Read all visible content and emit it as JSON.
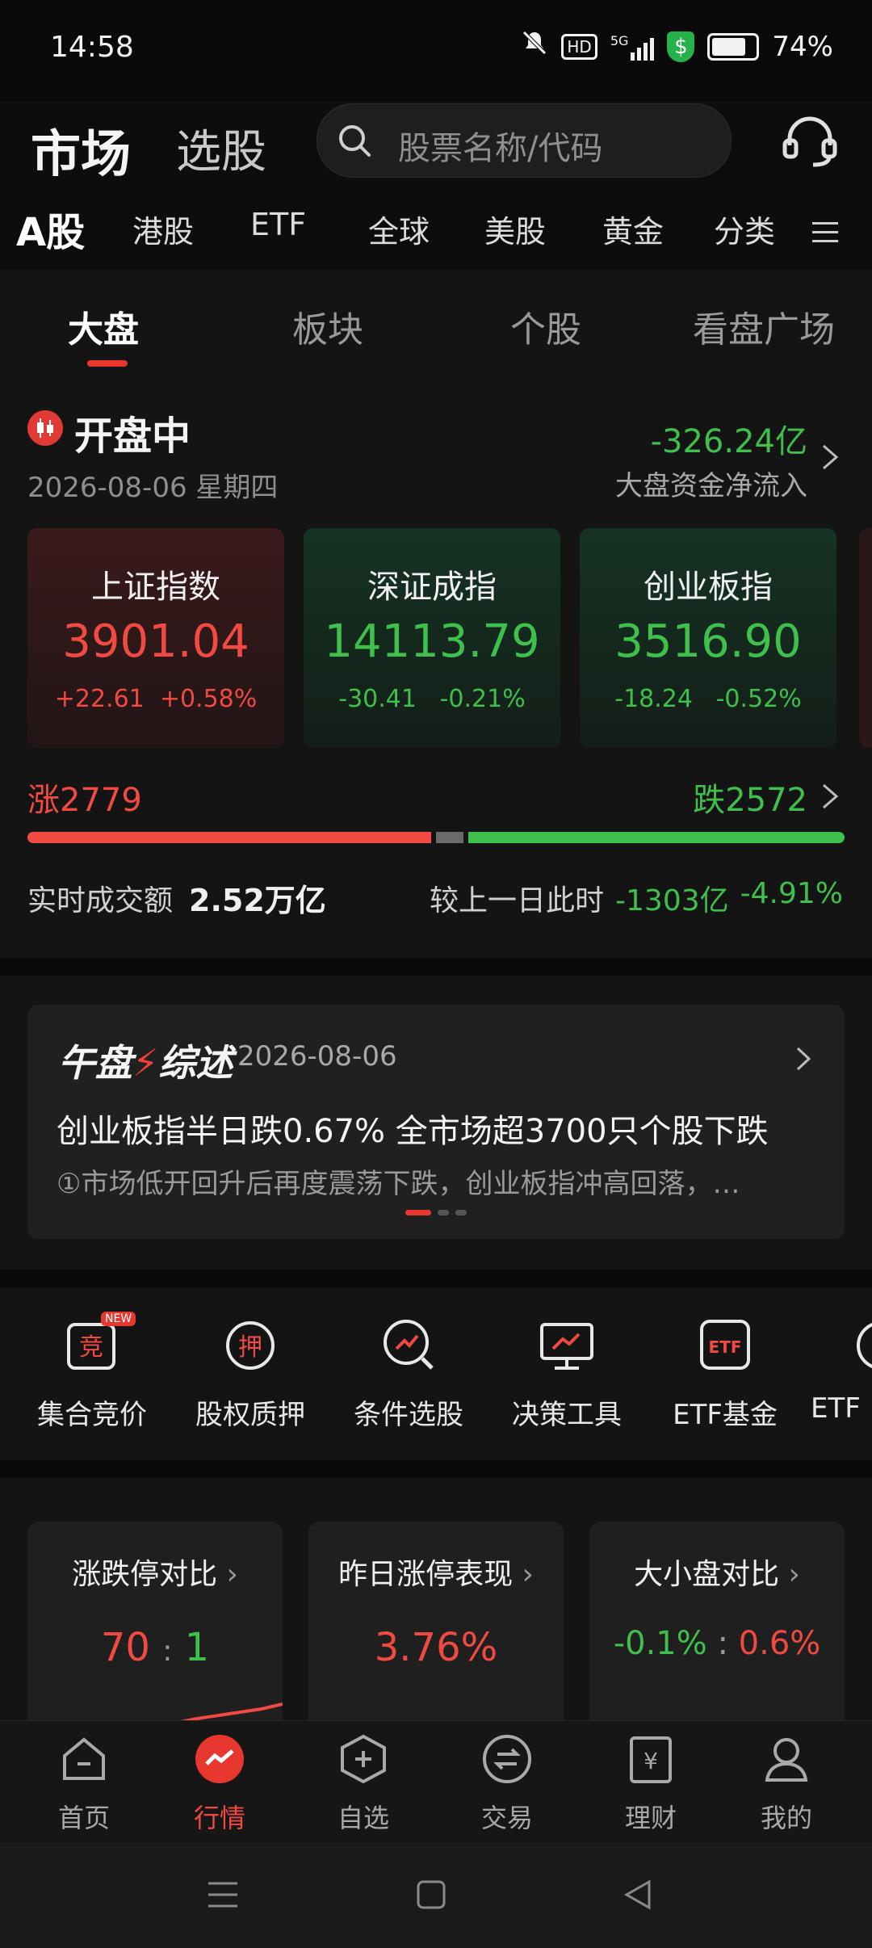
{
  "status_bar": {
    "time": "14:58",
    "battery": "74%",
    "hd": "HD",
    "network": "5G"
  },
  "header": {
    "market_label": "市场",
    "stock_pick_label": "选股",
    "search_placeholder": "股票名称/代码"
  },
  "market_tabs": [
    "A股",
    "港股",
    "ETF",
    "全球",
    "美股",
    "黄金",
    "分类"
  ],
  "sub_tabs": [
    "大盘",
    "板块",
    "个股",
    "看盘广场"
  ],
  "market_status": {
    "status": "开盘中",
    "date": "2026-08-06 星期四",
    "net_flow": "-326.24亿",
    "net_flow_label": "大盘资金净流入"
  },
  "indices": [
    {
      "name": "上证指数",
      "value": "3901.04",
      "change": "+22.61",
      "pct": "+0.58%",
      "trend": "up"
    },
    {
      "name": "深证成指",
      "value": "14113.79",
      "change": "-30.41",
      "pct": "-0.21%",
      "trend": "down"
    },
    {
      "name": "创业板指",
      "value": "3516.90",
      "change": "-18.24",
      "pct": "-0.52%",
      "trend": "down"
    }
  ],
  "breadth": {
    "rise_label": "涨",
    "rise": "2779",
    "fall_label": "跌",
    "fall": "2572",
    "rise_fraction": 0.519
  },
  "turnover": {
    "label": "实时成交额",
    "value": "2.52万亿",
    "compare_label": "较上一日此时",
    "compare_value": "-1303亿",
    "compare_pct": "-4.91%"
  },
  "noon_summary": {
    "logo_a": "午盘",
    "logo_b": "综述",
    "date": "2026-08-06",
    "title": "创业板指半日跌0.67% 全市场超3700只个股下跌",
    "subtitle": "①市场低开回升后再度震荡下跌，创业板指冲高回落，…"
  },
  "tools": [
    {
      "label": "集合竞价",
      "icon": "auction-icon",
      "badge": "NEW",
      "glyph": "竞"
    },
    {
      "label": "股权质押",
      "icon": "pledge-icon",
      "glyph": "押"
    },
    {
      "label": "条件选股",
      "icon": "condition-pick-icon"
    },
    {
      "label": "决策工具",
      "icon": "decision-tool-icon"
    },
    {
      "label": "ETF基金",
      "icon": "etf-fund-icon",
      "glyph": "ETF"
    },
    {
      "label": "ETF",
      "icon": "etf-more-icon"
    }
  ],
  "stat_cards": [
    {
      "title": "涨跌停对比",
      "left": "70",
      "sep": ":",
      "right": "1"
    },
    {
      "title": "昨日涨停表现",
      "value": "3.76%"
    },
    {
      "title": "大小盘对比",
      "left": "-0.1%",
      "sep": ":",
      "right": "0.6%"
    }
  ],
  "bottom_nav": [
    {
      "label": "首页",
      "icon": "home-icon"
    },
    {
      "label": "行情",
      "icon": "market-icon",
      "active": true
    },
    {
      "label": "自选",
      "icon": "watchlist-icon"
    },
    {
      "label": "交易",
      "icon": "trade-icon"
    },
    {
      "label": "理财",
      "icon": "finance-icon"
    },
    {
      "label": "我的",
      "icon": "profile-icon"
    }
  ],
  "colors": {
    "up": "#f04a42",
    "down": "#3fbf4c",
    "accent": "#e8372f"
  }
}
